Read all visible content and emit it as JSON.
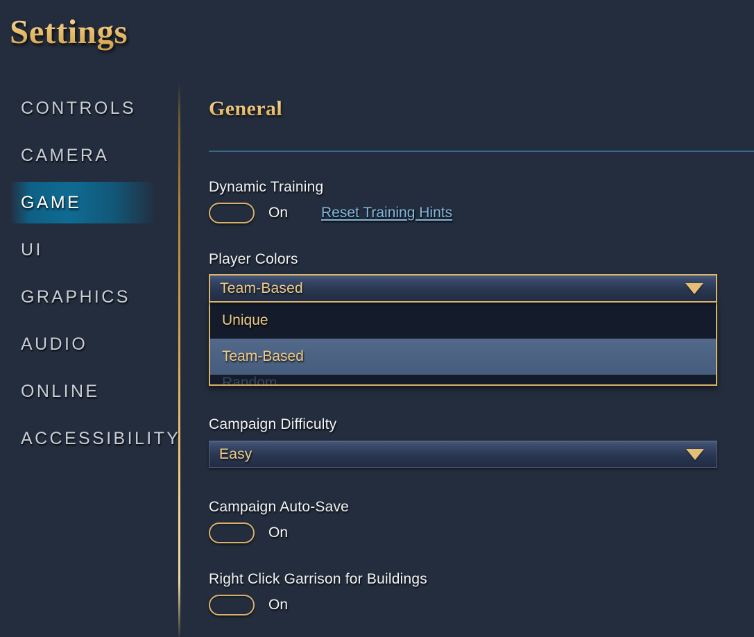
{
  "window": {
    "title": "Settings"
  },
  "sidebar": {
    "items": [
      {
        "label": "CONTROLS",
        "active": false
      },
      {
        "label": "CAMERA",
        "active": false
      },
      {
        "label": "GAME",
        "active": true
      },
      {
        "label": "UI",
        "active": false
      },
      {
        "label": "GRAPHICS",
        "active": false
      },
      {
        "label": "AUDIO",
        "active": false
      },
      {
        "label": "ONLINE",
        "active": false
      },
      {
        "label": "ACCESSIBILITY",
        "active": false
      }
    ]
  },
  "content": {
    "section_title": "General",
    "settings": {
      "dynamic_training": {
        "label": "Dynamic Training",
        "value": "On",
        "link_label": "Reset Training Hints"
      },
      "player_colors": {
        "label": "Player Colors",
        "value": "Team-Based",
        "expanded": true,
        "options": [
          {
            "label": "Unique",
            "selected": false
          },
          {
            "label": "Team-Based",
            "selected": true
          }
        ],
        "clipped_option": "Random"
      },
      "campaign_difficulty": {
        "label": "Campaign Difficulty",
        "value": "Easy",
        "expanded": false
      },
      "campaign_auto_save": {
        "label": "Campaign Auto-Save",
        "value": "On"
      },
      "right_click_garrison": {
        "label": "Right Click Garrison for Buildings",
        "value": "On"
      }
    }
  },
  "colors": {
    "gold": "#e8bf6e",
    "gold_bright": "#f6dfa4",
    "background": "#242d3d",
    "accent_blue": "#0f6b93",
    "link_blue": "#7fb6dd",
    "rule_blue": "#3a6b96",
    "option_highlight": "#4c6283",
    "panel_dark": "#141b2b"
  }
}
